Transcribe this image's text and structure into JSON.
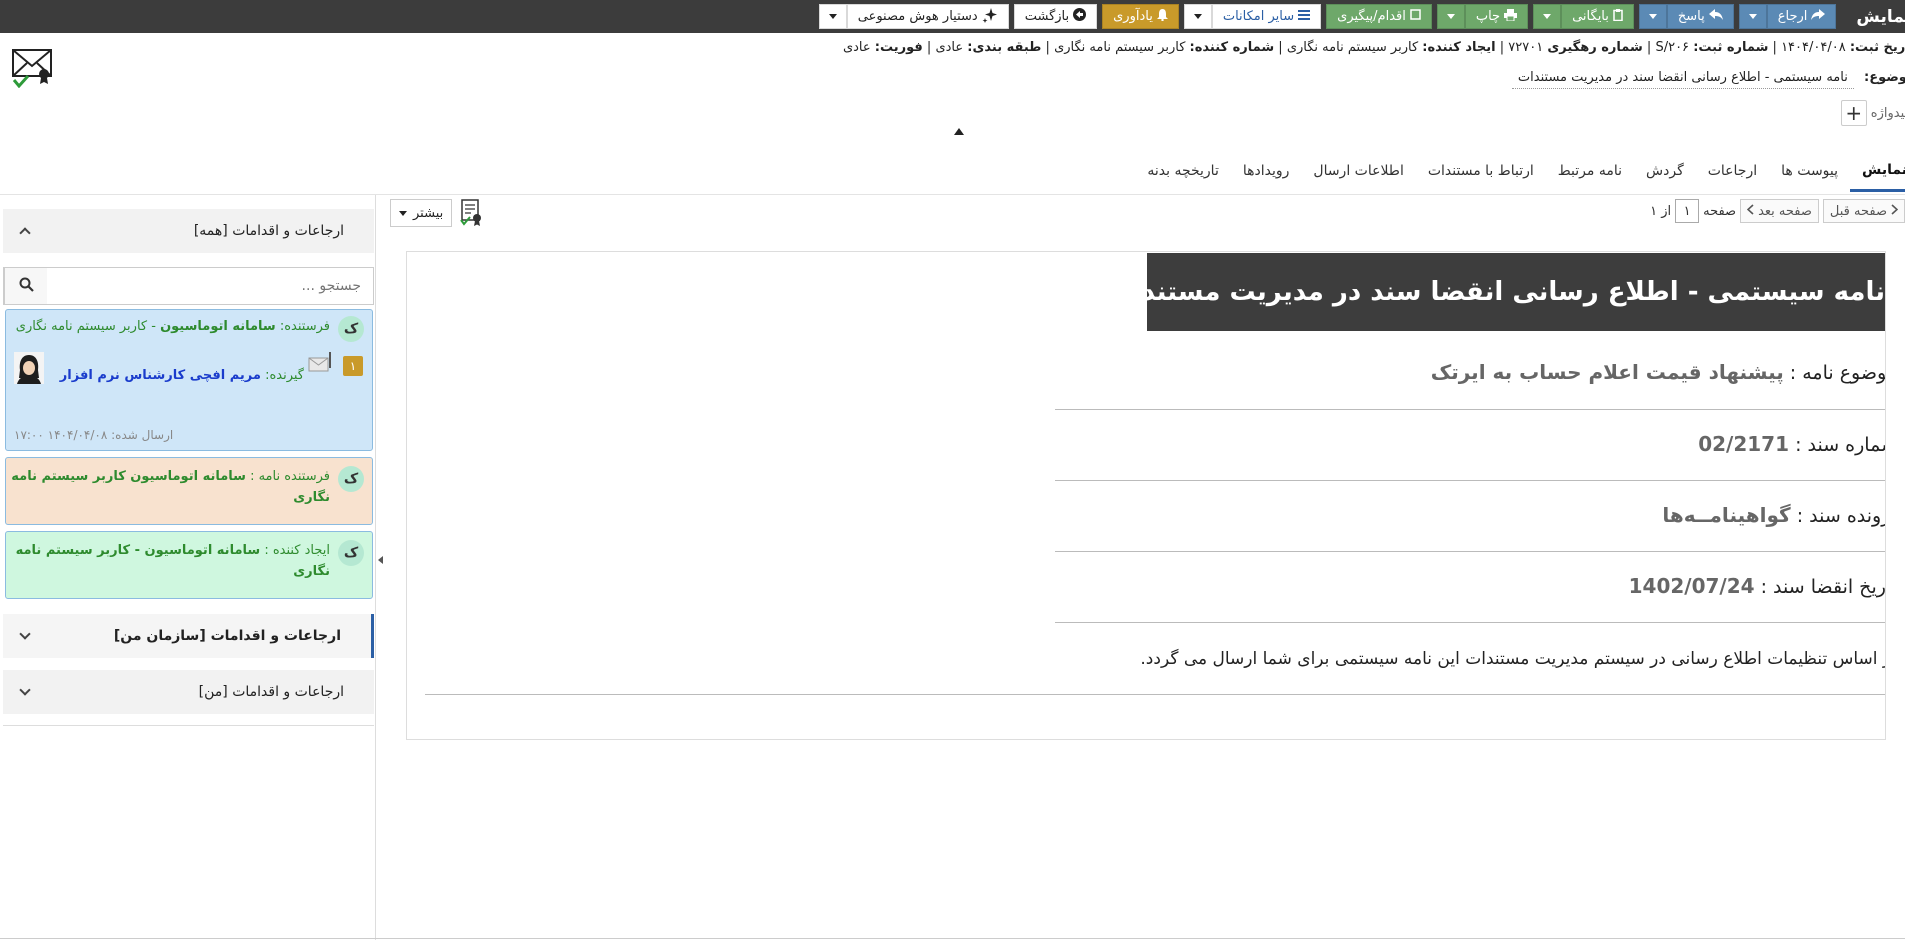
{
  "toolbar": {
    "title": "نمایش",
    "refer_label": "ارجاع",
    "reply_label": "پاسخ",
    "archive_label": "بایگانی",
    "print_label": "چاپ",
    "action_label": "اقدام/پیگیری",
    "more_options_label": "سایر امکانات",
    "reminder_label": "یادآوری",
    "back_label": "بازگشت",
    "ai_label": "دستیار هوش مصنوعی"
  },
  "meta": {
    "reg_date_label": "تاریخ ثبت:",
    "reg_date": "۱۴۰۴/۰۴/۰۸",
    "reg_no_label": "شماره ثبت:",
    "reg_no": "S/۲۰۶",
    "track_label": "شماره رهگیری",
    "track_no": "۷۲۷۰۱",
    "creator_label": "ایجاد کننده:",
    "creator": "کاربر سیستم نامه نگاری",
    "numberer_label": "شماره کننده:",
    "numberer": "کاربر سیستم نامه نگاری",
    "class_label": "طبقه بندی:",
    "class_value": "عادی",
    "urgency_label": "فوریت:",
    "urgency_value": "عادی",
    "subject_label": "موضوع:",
    "subject_value": "نامه سیستمی - اطلاع رسانی انقضا سند در مدیریت مستندات",
    "keywords_label": "کلیدواژه",
    "keywords_add": "+"
  },
  "tabs": [
    "نمایش",
    "پیوست ها",
    "ارجاعات",
    "گردش",
    "نامه مرتبط",
    "ارتباط با مستندات",
    "اطلاعات ارسال",
    "رویدادها",
    "تاریخچه بدنه"
  ],
  "left": {
    "all_header": "ارجاعات و اقدامات [همه]",
    "org_header": "ارجاعات و اقدامات [سازمان من]",
    "mine_header": "ارجاعات و اقدامات [من]",
    "search_placeholder": "جستجو ...",
    "card1": {
      "avatar": "ک",
      "sender_label": "فرستنده:",
      "sender_org": "سامانه اتوماسیون",
      "sender_user": "- کاربر سیستم نامه نگاری",
      "badge": "۱",
      "receiver_label": "گیرنده:",
      "receiver": "مریم افچی کارشناس نرم افزار",
      "sent_label": "ارسال شده:",
      "sent_time": "۱۴۰۴/۰۴/۰۸ ۱۷:۰۰"
    },
    "card2": {
      "avatar": "ک",
      "label": "فرستنده نامه :",
      "line1": "سامانه اتوماسیون کاربر سیستم نامه",
      "line2": "نگاری"
    },
    "card3": {
      "avatar": "ک",
      "label": "ایجاد کننده :",
      "line1": "سامانه اتوماسیون - کاربر سیستم نامه",
      "line2": "نگاری"
    }
  },
  "pager": {
    "prev": "صفحه قبل",
    "next": "صفحه بعد",
    "page_label": "صفحه",
    "page": "۱",
    "of": "از ۱"
  },
  "more_label": "بیشتر",
  "doc": {
    "title": "نامه سیستمی - اطلاع رسانی انقضا سند در مدیریت مستندات",
    "subject_label": "موضوع نامه :",
    "subject_value": "پیشنهاد قیمت اعلام حساب به ایرتک",
    "docno_label": "شماره سند :",
    "docno_value": "02/2171",
    "file_label": "پرونده سند :",
    "file_value": "گواهینامــه‌ها",
    "expiry_label": "تاریخ انقضا سند :",
    "expiry_value": "1402/07/24",
    "footer": "بر اساس تنظیمات اطلاع رسانی در سیستم مدیریت مستندات این نامه سیستمی برای شما ارسال می گردد."
  },
  "colors": {
    "toolbar_bg": "#3c3c3c",
    "btn_blue": "#5b8ab5",
    "btn_green": "#6ea86a",
    "btn_gold": "#c99a2a",
    "card_blue": "#cfe6f8",
    "card_orange": "#f8e2cf",
    "card_green": "#cff7df",
    "doc_title_bg": "#3d3d3d"
  }
}
